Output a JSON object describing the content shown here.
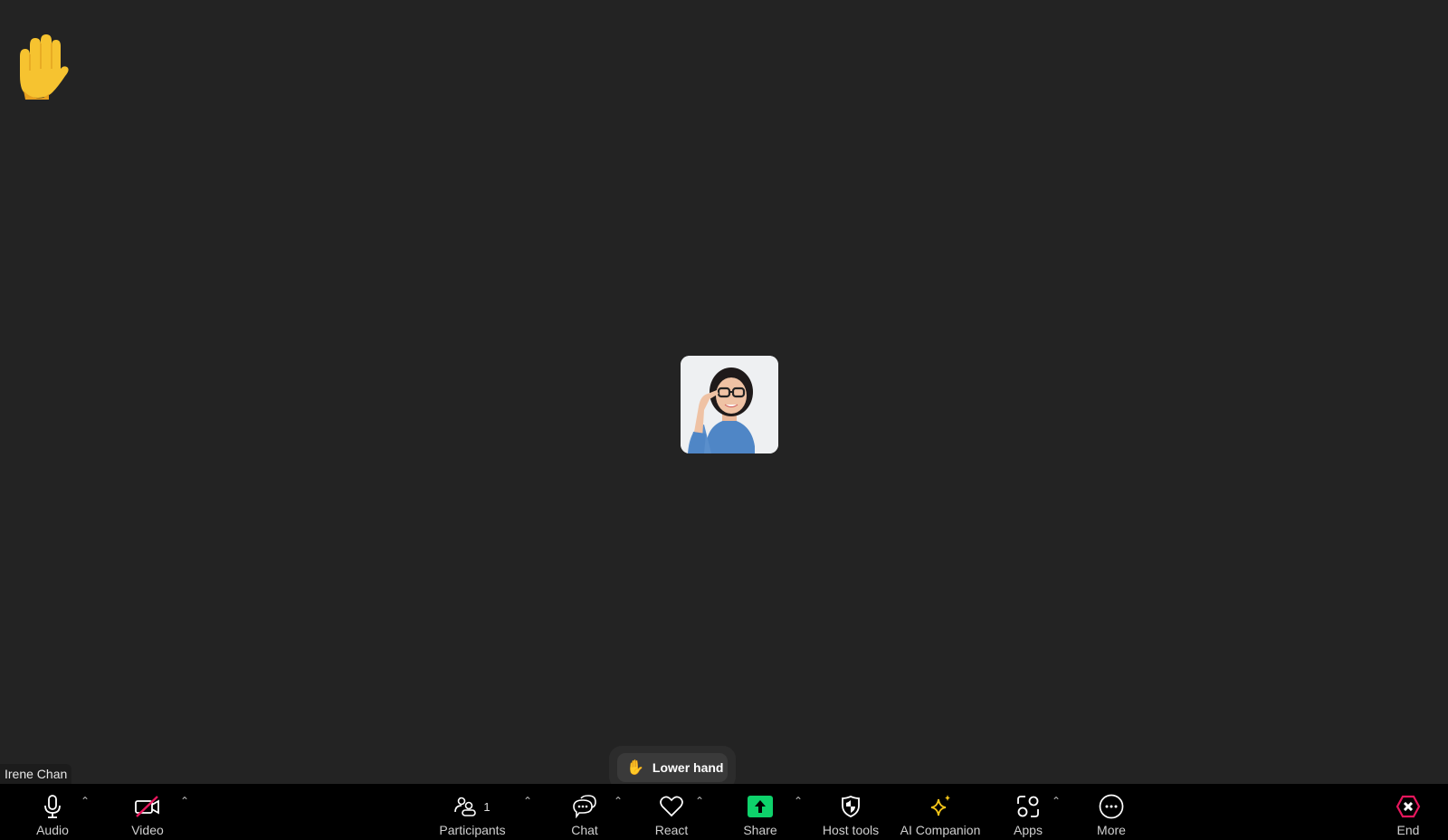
{
  "meeting": {
    "participant_name": "Irene Chan",
    "raised_hand_icon": "raised-hand-emoji"
  },
  "reaction_popup": {
    "lower_hand_label": "Lower hand",
    "icon": "raised-hand-emoji"
  },
  "toolbar": {
    "audio": {
      "label": "Audio",
      "icon": "microphone-icon"
    },
    "video": {
      "label": "Video",
      "icon": "video-off-icon",
      "state": "off"
    },
    "participants": {
      "label": "Participants",
      "count": "1",
      "icon": "participants-icon"
    },
    "chat": {
      "label": "Chat",
      "icon": "chat-icon"
    },
    "react": {
      "label": "React",
      "icon": "heart-icon"
    },
    "share": {
      "label": "Share",
      "icon": "share-screen-icon"
    },
    "host_tools": {
      "label": "Host tools",
      "icon": "shield-icon"
    },
    "ai_companion": {
      "label": "AI Companion",
      "icon": "sparkle-icon"
    },
    "apps": {
      "label": "Apps",
      "icon": "apps-icon"
    },
    "more": {
      "label": "More",
      "icon": "more-icon"
    },
    "end": {
      "label": "End",
      "icon": "end-icon"
    }
  },
  "colors": {
    "background": "#232323",
    "toolbar": "#000000",
    "share_green": "#0ed26b",
    "end_red": "#e8175d",
    "ai_gold": "#f5c518",
    "hand_yellow": "#f6c330"
  }
}
